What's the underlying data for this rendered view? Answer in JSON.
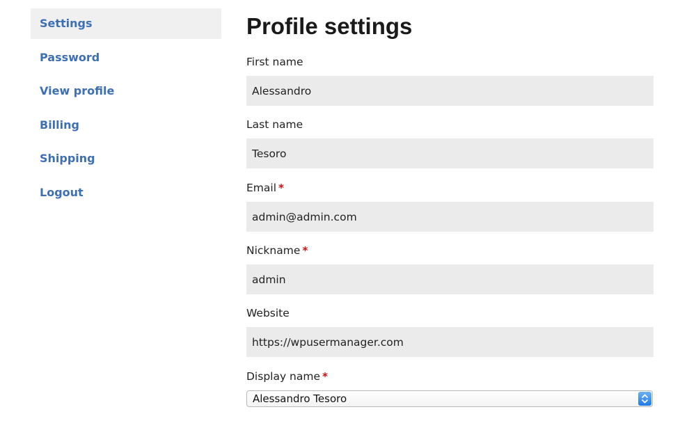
{
  "sidebar": {
    "items": [
      {
        "label": "Settings",
        "active": true
      },
      {
        "label": "Password",
        "active": false
      },
      {
        "label": "View profile",
        "active": false
      },
      {
        "label": "Billing",
        "active": false
      },
      {
        "label": "Shipping",
        "active": false
      },
      {
        "label": "Logout",
        "active": false
      }
    ]
  },
  "main": {
    "title": "Profile settings",
    "fields": {
      "first_name": {
        "label": "First name",
        "required": false,
        "value": "Alessandro"
      },
      "last_name": {
        "label": "Last name",
        "required": false,
        "value": "Tesoro"
      },
      "email": {
        "label": "Email",
        "required": true,
        "value": "admin@admin.com"
      },
      "nickname": {
        "label": "Nickname",
        "required": true,
        "value": "admin"
      },
      "website": {
        "label": "Website",
        "required": false,
        "value": "https://wpusermanager.com"
      },
      "display_name": {
        "label": "Display name",
        "required": true,
        "value": "Alessandro Tesoro"
      }
    },
    "required_marker": "*"
  },
  "colors": {
    "link": "#3d6fb5",
    "active_bg": "#f0f0f0",
    "input_bg": "#ebebeb",
    "required": "#cc1111",
    "select_accent": "#1f7ae8"
  },
  "icons": {
    "select_arrows": "up-down-chevron-icon"
  }
}
